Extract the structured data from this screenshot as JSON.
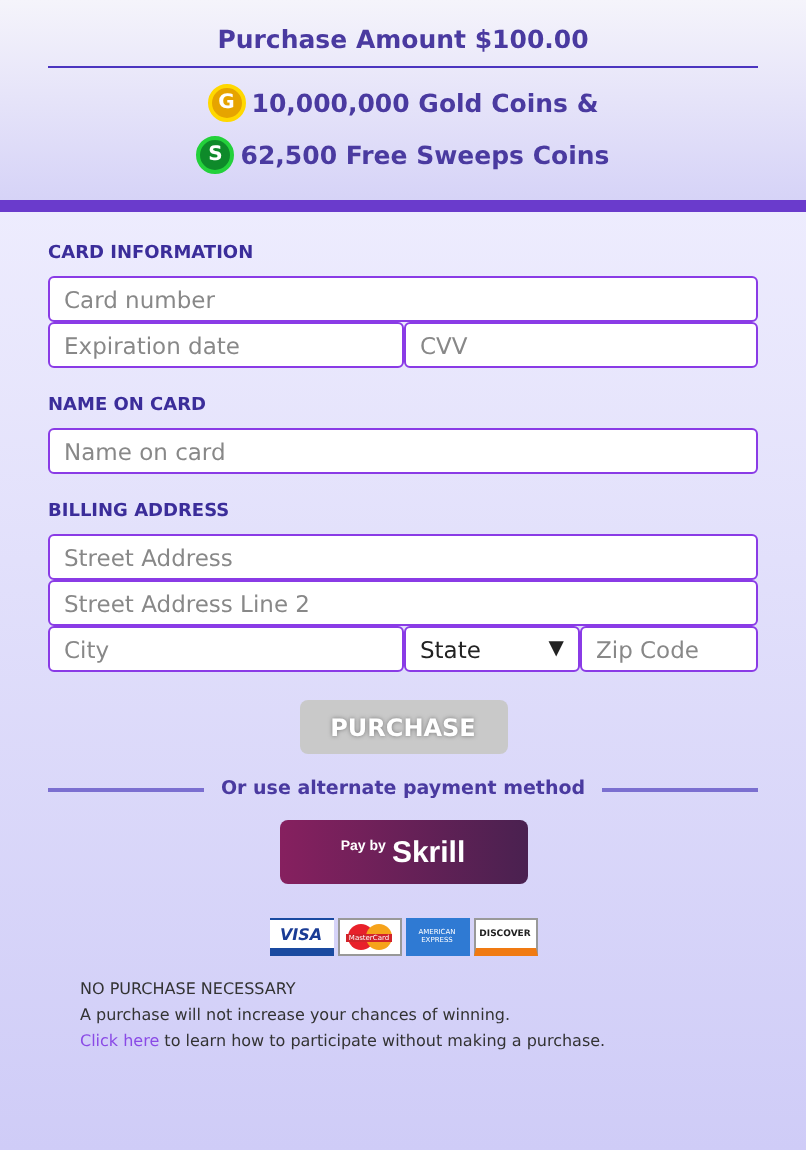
{
  "header": {
    "amount": "Purchase Amount $100.00",
    "rewards": [
      {
        "kind": "gold",
        "icon_letter": "G",
        "label": "10,000,000 Gold Coins &"
      },
      {
        "kind": "sweeps",
        "icon_letter": "S",
        "label": "62,500 Free Sweeps Coins"
      }
    ]
  },
  "sections": [
    {
      "title": "CARD INFORMATION",
      "rows": [
        [
          {
            "kind": "input",
            "placeholder": "Card number"
          }
        ],
        [
          {
            "kind": "input",
            "placeholder": "Expiration date"
          },
          {
            "kind": "input",
            "placeholder": "CVV"
          }
        ]
      ]
    },
    {
      "title": "NAME ON CARD",
      "rows": [
        [
          {
            "kind": "input",
            "placeholder": "Name on card"
          }
        ]
      ]
    },
    {
      "title": "BILLING ADDRESS",
      "rows": [
        [
          {
            "kind": "input",
            "placeholder": "Street Address"
          }
        ],
        [
          {
            "kind": "input",
            "placeholder": "Street Address Line 2"
          }
        ],
        [
          {
            "kind": "input",
            "placeholder": "City"
          },
          {
            "kind": "select",
            "value": "State",
            "caret": "▼"
          },
          {
            "kind": "input",
            "placeholder": "Zip Code"
          }
        ]
      ]
    }
  ],
  "purchase_button": {
    "label": "PURCHASE",
    "disabled": true
  },
  "alternate": {
    "label": "Or use alternate payment method",
    "skrill": {
      "prefix": "Pay by",
      "brand": "Skrill"
    }
  },
  "cards": [
    {
      "kind": "visa",
      "label": "VISA"
    },
    {
      "kind": "mastercard",
      "label": "MasterCard"
    },
    {
      "kind": "amex",
      "label": "AMERICAN EXPRESS"
    },
    {
      "kind": "discover",
      "label": "DISCOVER"
    }
  ],
  "notice": {
    "lines": [
      "NO PURCHASE NECESSARY",
      "A purchase will not increase your chances of winning."
    ],
    "link": "Click here",
    "link_rest": " to learn how to participate without making a purchase."
  }
}
